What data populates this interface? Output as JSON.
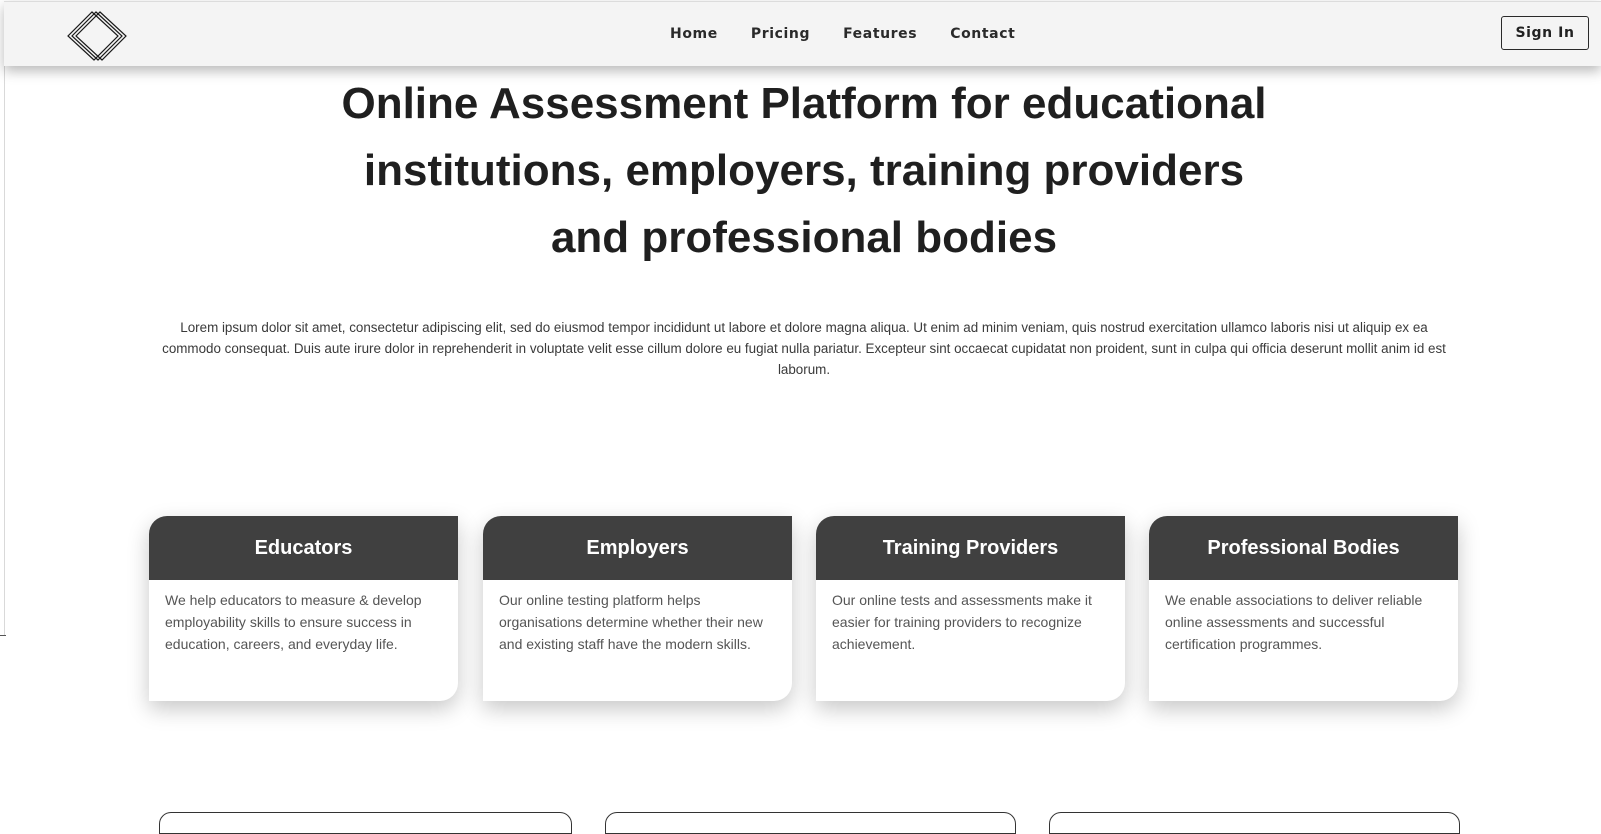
{
  "nav": {
    "logo_icon": "diamond-layers-logo-icon",
    "links": [
      "Home",
      "Pricing",
      "Features",
      "Contact"
    ],
    "signin_label": "Sign In"
  },
  "hero": {
    "title_lines": [
      "Online Assessment Platform for educational",
      "institutions, employers, training providers",
      "and professional bodies"
    ],
    "description": "Lorem ipsum dolor sit amet, consectetur adipiscing elit, sed do eiusmod tempor incididunt ut labore et dolore magna aliqua. Ut enim ad minim veniam, quis nostrud exercitation ullamco laboris nisi ut aliquip ex ea commodo consequat. Duis aute irure dolor in reprehenderit in voluptate velit esse cillum dolore eu fugiat nulla pariatur. Excepteur sint occaecat cupidatat non proident, sunt in culpa qui officia deserunt mollit anim id est laborum."
  },
  "cards": [
    {
      "title": "Educators",
      "text": "We help educators to measure & develop employability skills to ensure success in education, careers, and everyday life."
    },
    {
      "title": "Employers",
      "text": "Our online testing platform helps organisations determine whether their new and existing staff have the modern skills."
    },
    {
      "title": "Training Providers",
      "text": "Our online tests and assessments make it easier for training providers to recognize achievement."
    },
    {
      "title": "Professional Bodies",
      "text": "We enable associations to deliver reliable online assessments and successful certification programmes."
    }
  ],
  "colors": {
    "navbar_bg": "#f4f4f4",
    "card_header_bg": "#404040",
    "text_dark": "#1f1f1f",
    "text_muted": "#555555"
  }
}
